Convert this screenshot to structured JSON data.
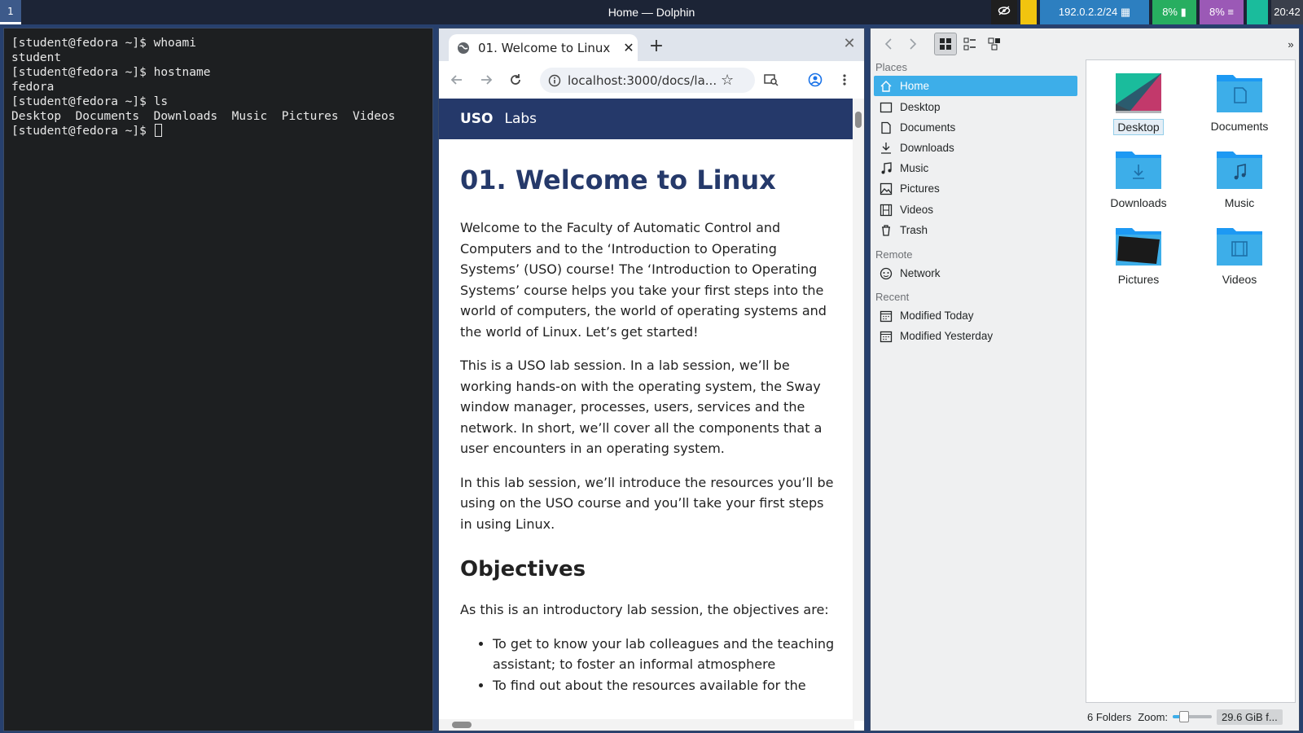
{
  "topbar": {
    "workspace": "1",
    "window_title": "Home — Dolphin",
    "ip": "192.0.2.2/24",
    "battery": "8%",
    "cpu": "8%",
    "clock": "20:42"
  },
  "terminal": {
    "lines": [
      "[student@fedora ~]$ whoami",
      "student",
      "[student@fedora ~]$ hostname",
      "fedora",
      "[student@fedora ~]$ ls",
      "Desktop  Documents  Downloads  Music  Pictures  Videos"
    ],
    "prompt": "[student@fedora ~]$ "
  },
  "browser": {
    "tab_title": "01. Welcome to Linux",
    "url": "localhost:3000/docs/la...",
    "site_brand": "USO",
    "site_nav_link": "Labs",
    "article": {
      "title": "01. Welcome to Linux",
      "p1": "Welcome to the Faculty of Automatic Control and Computers and to the ‘Introduction to Operating Systems’ (USO) course! The ‘Introduction to Operating Systems’ course helps you take your first steps into the world of computers, the world of operating systems and the world of Linux. Let’s get started!",
      "p2": "This is a USO lab session. In a lab session, we’ll be working hands-on with the operating system, the Sway window manager, processes, users, services and the network. In short, we’ll cover all the components that a user encounters in an operating system.",
      "p3": "In this lab session, we’ll introduce the resources you’ll be using on the USO course and you’ll take your first steps in using Linux.",
      "h2": "Objectives",
      "p4": "As this is an introductory lab session, the objectives are:",
      "bullets": [
        "To get to know your lab colleagues and the teaching assistant; to foster an informal atmosphere",
        "To find out about the resources available for the"
      ]
    }
  },
  "dolphin": {
    "places_header": "Places",
    "places": [
      "Home",
      "Desktop",
      "Documents",
      "Downloads",
      "Music",
      "Pictures",
      "Videos",
      "Trash"
    ],
    "remote_header": "Remote",
    "remote": [
      "Network"
    ],
    "recent_header": "Recent",
    "recent": [
      "Modified Today",
      "Modified Yesterday"
    ],
    "folders": [
      "Desktop",
      "Documents",
      "Downloads",
      "Music",
      "Pictures",
      "Videos"
    ],
    "status_count": "6 Folders",
    "zoom_label": "Zoom:",
    "zoom_level": 0.3,
    "free_space": "29.6 GiB f...",
    "colors": {
      "accent": "#3daee9",
      "folder": "#3daee9"
    }
  }
}
